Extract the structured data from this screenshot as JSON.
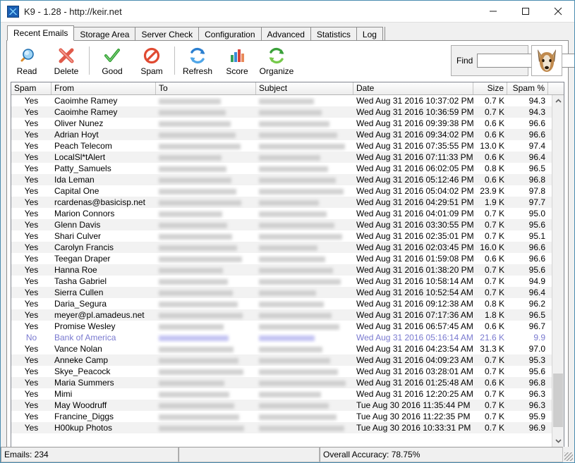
{
  "window": {
    "title": "K9 - 1.28 - http://keir.net",
    "icon": "k9-app-icon",
    "minimize_label": "Minimize",
    "maximize_label": "Maximize",
    "close_label": "Close"
  },
  "tabs": [
    {
      "label": "Recent Emails",
      "active": true
    },
    {
      "label": "Storage Area",
      "active": false
    },
    {
      "label": "Server Check",
      "active": false
    },
    {
      "label": "Configuration",
      "active": false
    },
    {
      "label": "Advanced",
      "active": false
    },
    {
      "label": "Statistics",
      "active": false
    },
    {
      "label": "Log",
      "active": false
    }
  ],
  "toolbar": {
    "buttons": [
      {
        "label": "Read",
        "icon": "magnifier-icon"
      },
      {
        "label": "Delete",
        "icon": "red-x-icon"
      },
      {
        "label": "Good",
        "icon": "green-check-icon"
      },
      {
        "label": "Spam",
        "icon": "no-entry-icon"
      },
      {
        "label": "Refresh",
        "icon": "blue-refresh-icon"
      },
      {
        "label": "Score",
        "icon": "bar-chart-icon"
      },
      {
        "label": "Organize",
        "icon": "green-refresh-icon"
      }
    ],
    "find": {
      "label": "Find",
      "value": "",
      "placeholder": ""
    },
    "mascot": "dog-head-icon"
  },
  "grid": {
    "columns": [
      {
        "key": "spam",
        "label": "Spam",
        "align": "center"
      },
      {
        "key": "from",
        "label": "From",
        "align": "left"
      },
      {
        "key": "to",
        "label": "To",
        "align": "left"
      },
      {
        "key": "subject",
        "label": "Subject",
        "align": "left"
      },
      {
        "key": "date",
        "label": "Date",
        "align": "left"
      },
      {
        "key": "size",
        "label": "Size",
        "align": "right"
      },
      {
        "key": "pct",
        "label": "Spam %",
        "align": "right"
      }
    ],
    "rows": [
      {
        "spam": "Yes",
        "from": "Caoimhe Ramey",
        "to": "",
        "subject": "",
        "date": "Wed Aug 31 2016  10:37:02 PM",
        "size": "0.7 K",
        "pct": "94.3",
        "selected": false
      },
      {
        "spam": "Yes",
        "from": "Caoimhe Ramey",
        "to": "",
        "subject": "",
        "date": "Wed Aug 31 2016  10:36:59 PM",
        "size": "0.7 K",
        "pct": "94.3",
        "selected": false
      },
      {
        "spam": "Yes",
        "from": "Oliver Nunez",
        "to": "",
        "subject": "",
        "date": "Wed Aug 31 2016  09:39:38 PM",
        "size": "0.6 K",
        "pct": "96.6",
        "selected": false
      },
      {
        "spam": "Yes",
        "from": "Adrian Hoyt",
        "to": "",
        "subject": "",
        "date": "Wed Aug 31 2016  09:34:02 PM",
        "size": "0.6 K",
        "pct": "96.6",
        "selected": false
      },
      {
        "spam": "Yes",
        "from": "Peach Telecom",
        "to": "",
        "subject": "",
        "date": "Wed Aug 31 2016  07:35:55 PM",
        "size": "13.0 K",
        "pct": "97.4",
        "selected": false
      },
      {
        "spam": "Yes",
        "from": "LocalSl*tAlert",
        "to": "",
        "subject": "",
        "date": "Wed Aug 31 2016  07:11:33 PM",
        "size": "0.6 K",
        "pct": "96.4",
        "selected": false
      },
      {
        "spam": "Yes",
        "from": "Patty_Samuels",
        "to": "",
        "subject": "",
        "date": "Wed Aug 31 2016  06:02:05 PM",
        "size": "0.8 K",
        "pct": "96.5",
        "selected": false
      },
      {
        "spam": "Yes",
        "from": "Ida Leman",
        "to": "",
        "subject": "",
        "date": "Wed Aug 31 2016  05:12:46 PM",
        "size": "0.6 K",
        "pct": "96.8",
        "selected": false
      },
      {
        "spam": "Yes",
        "from": "Capital One",
        "to": "",
        "subject": "",
        "date": "Wed Aug 31 2016  05:04:02 PM",
        "size": "23.9 K",
        "pct": "97.8",
        "selected": false
      },
      {
        "spam": "Yes",
        "from": "rcardenas@basicisp.net",
        "to": "",
        "subject": "",
        "date": "Wed Aug 31 2016  04:29:51 PM",
        "size": "1.9 K",
        "pct": "97.7",
        "selected": false
      },
      {
        "spam": "Yes",
        "from": "Marion Connors",
        "to": "",
        "subject": "",
        "date": "Wed Aug 31 2016  04:01:09 PM",
        "size": "0.7 K",
        "pct": "95.0",
        "selected": false
      },
      {
        "spam": "Yes",
        "from": "Glenn Davis",
        "to": "",
        "subject": "",
        "date": "Wed Aug 31 2016  03:30:55 PM",
        "size": "0.7 K",
        "pct": "95.6",
        "selected": false
      },
      {
        "spam": "Yes",
        "from": "Shari Culver",
        "to": "",
        "subject": "",
        "date": "Wed Aug 31 2016  02:35:01 PM",
        "size": "0.7 K",
        "pct": "95.1",
        "selected": false
      },
      {
        "spam": "Yes",
        "from": "Carolyn Francis",
        "to": "",
        "subject": "",
        "date": "Wed Aug 31 2016  02:03:45 PM",
        "size": "16.0 K",
        "pct": "96.6",
        "selected": false
      },
      {
        "spam": "Yes",
        "from": "Teegan Draper",
        "to": "",
        "subject": "",
        "date": "Wed Aug 31 2016  01:59:08 PM",
        "size": "0.6 K",
        "pct": "96.6",
        "selected": false
      },
      {
        "spam": "Yes",
        "from": "Hanna Roe",
        "to": "",
        "subject": "",
        "date": "Wed Aug 31 2016  01:38:20 PM",
        "size": "0.7 K",
        "pct": "95.6",
        "selected": false
      },
      {
        "spam": "Yes",
        "from": "Tasha Gabriel",
        "to": "",
        "subject": "",
        "date": "Wed Aug 31 2016  10:58:14 AM",
        "size": "0.7 K",
        "pct": "94.9",
        "selected": false
      },
      {
        "spam": "Yes",
        "from": "Sierra Cullen",
        "to": "",
        "subject": "",
        "date": "Wed Aug 31 2016  10:52:54 AM",
        "size": "0.7 K",
        "pct": "96.4",
        "selected": false
      },
      {
        "spam": "Yes",
        "from": "Daria_Segura",
        "to": "",
        "subject": "",
        "date": "Wed Aug 31 2016  09:12:38 AM",
        "size": "0.8 K",
        "pct": "96.2",
        "selected": false
      },
      {
        "spam": "Yes",
        "from": "meyer@pl.amadeus.net",
        "to": "",
        "subject": "",
        "date": "Wed Aug 31 2016  07:17:36 AM",
        "size": "1.8 K",
        "pct": "96.5",
        "selected": false
      },
      {
        "spam": "Yes",
        "from": "Promise Wesley",
        "to": "",
        "subject": "",
        "date": "Wed Aug 31 2016  06:57:45 AM",
        "size": "0.6 K",
        "pct": "96.7",
        "selected": false
      },
      {
        "spam": "No",
        "from": "Bank of America",
        "to": "",
        "subject": "",
        "date": "Wed Aug 31 2016  05:16:14 AM",
        "size": "21.6 K",
        "pct": "9.9",
        "selected": true
      },
      {
        "spam": "Yes",
        "from": "Vance Nolan",
        "to": "",
        "subject": "",
        "date": "Wed Aug 31 2016  04:23:54 AM",
        "size": "31.3 K",
        "pct": "97.0",
        "selected": false
      },
      {
        "spam": "Yes",
        "from": "Anneke Camp",
        "to": "",
        "subject": "",
        "date": "Wed Aug 31 2016  04:09:23 AM",
        "size": "0.7 K",
        "pct": "95.3",
        "selected": false
      },
      {
        "spam": "Yes",
        "from": "Skye_Peacock",
        "to": "",
        "subject": "",
        "date": "Wed Aug 31 2016  03:28:01 AM",
        "size": "0.7 K",
        "pct": "95.6",
        "selected": false
      },
      {
        "spam": "Yes",
        "from": "Maria Summers",
        "to": "",
        "subject": "",
        "date": "Wed Aug 31 2016  01:25:48 AM",
        "size": "0.6 K",
        "pct": "96.8",
        "selected": false
      },
      {
        "spam": "Yes",
        "from": "Mimi",
        "to": "",
        "subject": "",
        "date": "Wed Aug 31 2016  12:20:25 AM",
        "size": "0.7 K",
        "pct": "96.3",
        "selected": false
      },
      {
        "spam": "Yes",
        "from": "May Woodruff",
        "to": "",
        "subject": "",
        "date": "Tue Aug 30 2016  11:35:44 PM",
        "size": "0.7 K",
        "pct": "96.3",
        "selected": false
      },
      {
        "spam": "Yes",
        "from": "Francine_Diggs",
        "to": "",
        "subject": "",
        "date": "Tue Aug 30 2016  11:22:35 PM",
        "size": "0.7 K",
        "pct": "95.9",
        "selected": false
      },
      {
        "spam": "Yes",
        "from": "H00kup Photos",
        "to": "",
        "subject": "",
        "date": "Tue Aug 30 2016  10:33:31 PM",
        "size": "0.7 K",
        "pct": "96.9",
        "selected": false
      }
    ]
  },
  "statusbar": {
    "emails": "Emails: 234",
    "middle": "",
    "accuracy": "Overall Accuracy: 78.75%"
  },
  "colors": {
    "accent": "#4a8cb0",
    "selected_text": "#7a7ad0",
    "row_alt": "#f2f2f2"
  }
}
